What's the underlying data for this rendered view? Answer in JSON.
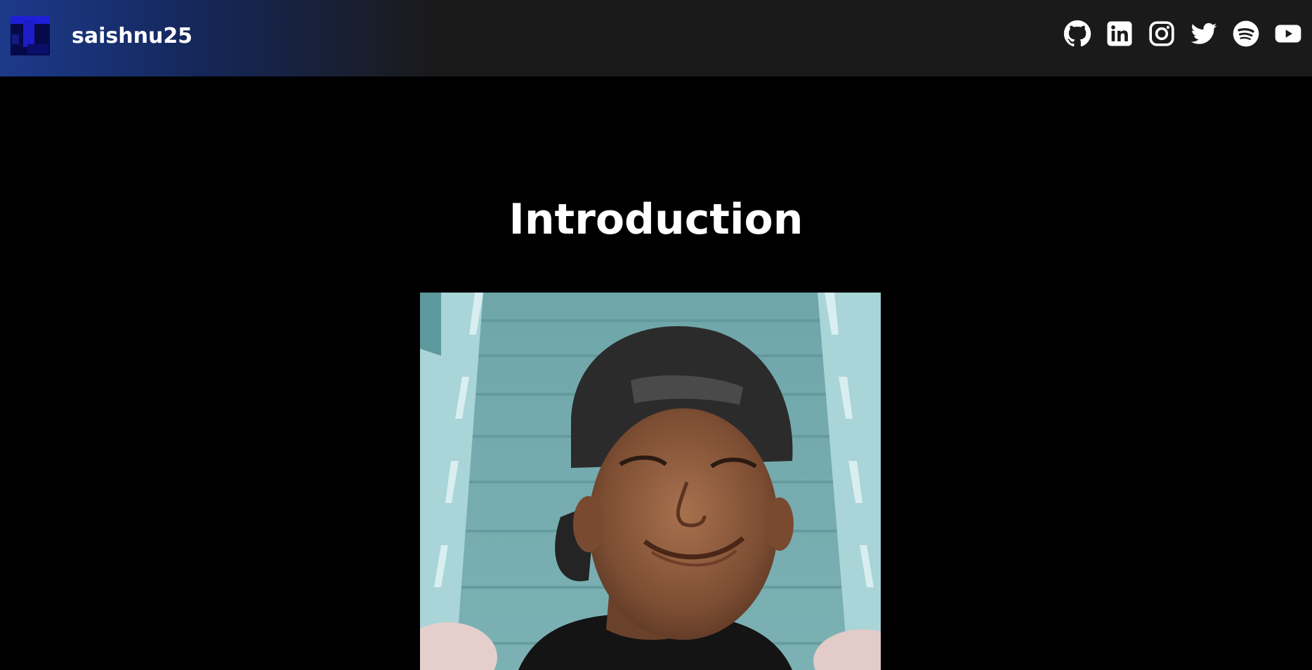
{
  "header": {
    "site_title": "saishnu25",
    "social_links": [
      "github",
      "linkedin",
      "instagram",
      "twitter",
      "spotify",
      "youtube"
    ]
  },
  "main": {
    "heading": "Introduction",
    "photo_alt": "profile photo"
  },
  "colors": {
    "header_bg": "#1a1a1a",
    "header_accent": "#1d3a8a",
    "page_bg": "#000000",
    "text": "#ffffff"
  }
}
